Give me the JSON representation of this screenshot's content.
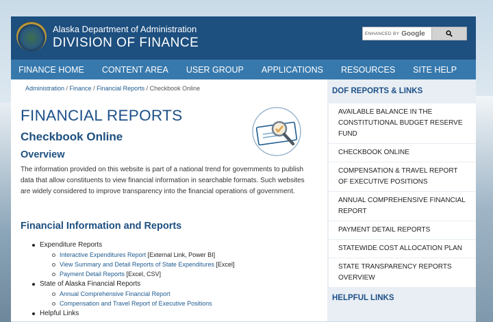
{
  "header": {
    "department": "Alaska Department of Administration",
    "division": "DIVISION OF FINANCE",
    "search": {
      "enhanced_by": "ENHANCED BY",
      "provider": "Google"
    }
  },
  "nav": [
    "FINANCE HOME",
    "CONTENT AREA",
    "USER GROUP",
    "APPLICATIONS",
    "RESOURCES",
    "SITE HELP"
  ],
  "breadcrumb": {
    "items": [
      "Administration",
      "Finance",
      "Financial Reports"
    ],
    "current": "Checkbook Online",
    "separator": " / "
  },
  "main": {
    "title": "FINANCIAL REPORTS",
    "subtitle": "Checkbook Online",
    "overview_heading": "Overview",
    "overview_text": "The information provided on this website is part of a national trend for governments to publish data that allow constituents to view financial information in searchable formats. Such websites are widely considered to improve transparency into the financial operations of government.",
    "section_heading": "Financial Information and Reports",
    "lists": [
      {
        "label": "Expenditure Reports",
        "items": [
          {
            "link": "Interactive Expenditures Report",
            "note": " [External Link, Power BI]"
          },
          {
            "link": "View Summary and Detail Reports of State Expenditures",
            "note": " [Excel]"
          },
          {
            "link": "Payment Detail Reports",
            "note": " [Excel, CSV]"
          }
        ]
      },
      {
        "label": "State of Alaska Financial Reports",
        "items": [
          {
            "link": "Annual Comprehensive Financial Report",
            "note": ""
          },
          {
            "link": "Compensation and Travel Report of Executive Positions",
            "note": ""
          }
        ]
      },
      {
        "label": "Helpful Links",
        "items": []
      }
    ]
  },
  "sidebar": {
    "heading": "DOF REPORTS & LINKS",
    "items": [
      "AVAILABLE BALANCE IN THE CONSTITUTIONAL BUDGET RESERVE FUND",
      "CHECKBOOK ONLINE",
      "COMPENSATION & TRAVEL REPORT OF EXECUTIVE POSITIONS",
      "ANNUAL COMPREHENSIVE FINANCIAL REPORT",
      "PAYMENT DETAIL REPORTS",
      "STATEWIDE COST ALLOCATION PLAN",
      "STATE TRANSPARENCY REPORTS OVERVIEW"
    ],
    "heading2": "HELPFUL LINKS"
  },
  "icons": {
    "search": "magnifier-icon",
    "seal": "alaska-seal-icon",
    "check": "check-magnifier-icon"
  },
  "colors": {
    "header": "#1d4f7f",
    "nav": "#3779ad",
    "link": "#1d5a8f",
    "heading": "#1d5088"
  }
}
